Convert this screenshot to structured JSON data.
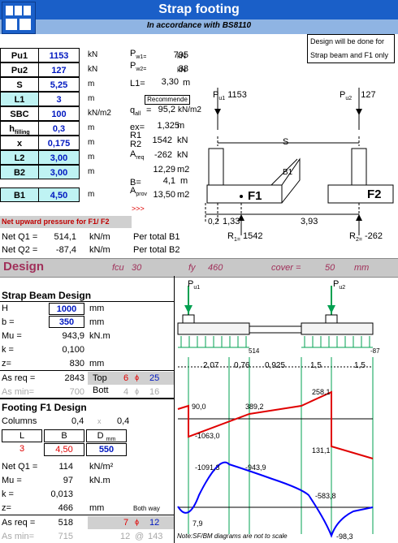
{
  "header": {
    "title": "Strap footing",
    "subtitle": "In accordance with BS8110"
  },
  "note_box": {
    "line1": "Design will be done for",
    "line2": "Strap beam and F1 only"
  },
  "inputs": [
    {
      "label": "Pu1",
      "value": "1153",
      "unit": "kN"
    },
    {
      "label": "Pu2",
      "value": "127",
      "unit": "kN"
    },
    {
      "label": "S",
      "value": "5,25",
      "unit": "m"
    },
    {
      "label": "L1",
      "value": "3",
      "unit": "m"
    },
    {
      "label": "SBC",
      "value": "100",
      "unit": "kN/m2"
    },
    {
      "label": "h",
      "label_sub": "filling",
      "value": "0,3",
      "unit": "m"
    },
    {
      "label": "x",
      "value": "0,175",
      "unit": "m"
    },
    {
      "label": "L2",
      "value": "3,00",
      "unit": "m"
    },
    {
      "label": "B2",
      "value": "3,00",
      "unit": "m"
    },
    {
      "label": "B1",
      "value": "4,50",
      "unit": "m"
    }
  ],
  "results": {
    "pw1_label": "P",
    "pw1_sub": "w1=",
    "pw1_value": "795",
    "pw1_unit": "kN",
    "pw2_label": "P",
    "pw2_sub": "w2=",
    "pw2_value": "88",
    "pw2_unit": "kN",
    "l1_label": "L1=",
    "l1_value": "3,30",
    "l1_unit": "m",
    "recommended": "Recommende",
    "qall_label": "q",
    "qall_sub": "all",
    "qall_eq": "=",
    "qall_value": "95,2",
    "qall_unit": "kN/m2",
    "ex_label": "ex=",
    "ex_value": "1,325",
    "ex_unit": "m",
    "r1_label": "R1",
    "r1_value": "1542",
    "r1_unit": "kN",
    "r2_label": "R2",
    "r2_value": "-262",
    "r2_unit": "kN",
    "areq_label": "A",
    "areq_sub": "req",
    "areq_value": "12,29",
    "areq_unit": "m2",
    "b_label": "B=",
    "b_value": "4,1",
    "b_unit": "m",
    "aprov_label": "A",
    "aprov_sub": "prov",
    "aprov_value": "13,50",
    "aprov_unit": "m2",
    "arrows": ">>>"
  },
  "net_pressure": {
    "heading": "Net upward pressure for F1/ F2",
    "q1_label": "Net Q1 =",
    "q1_value": "514,1",
    "q1_unit": "kN/m",
    "q1_note": "Per total B1",
    "q2_label": "Net Q2 =",
    "q2_value": "-87,4",
    "q2_unit": "kN/m",
    "q2_note": "Per total B2"
  },
  "design_band": {
    "title": "Design",
    "fcu_label": "fcu",
    "fcu_value": "30",
    "fy_label": "fy",
    "fy_value": "460",
    "cover_label": "cover =",
    "cover_value": "50",
    "cover_unit": "mm"
  },
  "strap_beam": {
    "heading": "Strap  Beam Design",
    "h_label": "H",
    "h_value": "1000",
    "h_unit": "mm",
    "b_label": "b =",
    "b_value": "350",
    "b_unit": "mm",
    "mu_label": "Mu =",
    "mu_value": "943,9",
    "mu_unit": "kN.m",
    "k_label": "k =",
    "k_value": "0,100",
    "z_label": "z=",
    "z_value": "830",
    "z_unit": "mm",
    "asreq_label": "As req =",
    "asreq_value": "2843",
    "top_label": "Top",
    "top_n": "6",
    "phi": "ϕ",
    "top_d": "25",
    "asmin_label": "As min=",
    "asmin_value": "700",
    "bott_label": "Bott",
    "bott_n": "4",
    "bott_d": "16"
  },
  "footing_f1": {
    "heading": "Footing F1 Design",
    "columns_label": "Columns",
    "col_a": "0,4",
    "col_x": "x",
    "col_b": "0,4",
    "l_label": "L",
    "b_label": "B",
    "d_label": "D",
    "d_sub": "mm",
    "l_value": "3",
    "b_value": "4,50",
    "d_value": "550",
    "netq1_label": "Net Q1 =",
    "netq1_value": "114",
    "netq1_unit": "kN/m²",
    "mu_label": "Mu =",
    "mu_value": "97",
    "mu_unit": "kN.m",
    "k_label": "k =",
    "k_value": "0,013",
    "z_label": "z=",
    "z_value": "466",
    "z_unit": "mm",
    "both_way": "Both way",
    "asreq_label": "As req =",
    "asreq_value": "518",
    "bar_n": "7",
    "phi": "ϕ",
    "bar_d": "12",
    "asmin_label": "As min=",
    "asmin_value": "715",
    "spacing_a": "12",
    "at": "@",
    "spacing_b": "143"
  },
  "plan_sketch": {
    "pu1_label": "P",
    "pu1_sub": "u1",
    "pu1_value": "1153",
    "pu2_label": "P",
    "pu2_sub": "u2",
    "pu2_value": "127",
    "s_label": "S",
    "b1_label": "B1",
    "f1_label": "F1",
    "f2_label": "F2",
    "dim1": "0,2",
    "dim2": "1,33",
    "dim3": "3,93",
    "r1_label": "R",
    "r1_sub": "1=",
    "r1_value": "1542",
    "r2_label": "R",
    "r2_sub": "2=",
    "r2_value": "-262"
  },
  "diagram": {
    "pu1_label": "P",
    "pu1_sub": "u1",
    "pu2_label": "P",
    "pu2_sub": "u2",
    "q1": "514",
    "q2": "-87",
    "spans": [
      "2,07",
      "0,76",
      "0,925",
      "1,5",
      "1,5"
    ],
    "sf_labels": [
      "90,0",
      "389,2",
      "258,1",
      "-1063,0",
      "131,1"
    ],
    "bm_labels": [
      "-1091,3",
      "-943,9",
      "-583,8",
      "7,9",
      "-98,3"
    ],
    "note": "Note:SF/BM diagrams are not to scale"
  },
  "colors": {
    "header_blue": "#1a5fc8",
    "sub_blue": "#8fb4e3",
    "input_blue": "#0018c0",
    "sf_red": "#e00000",
    "bm_blue": "#0000ff",
    "support_green": "#00a050",
    "teal": "#bff3f3"
  }
}
